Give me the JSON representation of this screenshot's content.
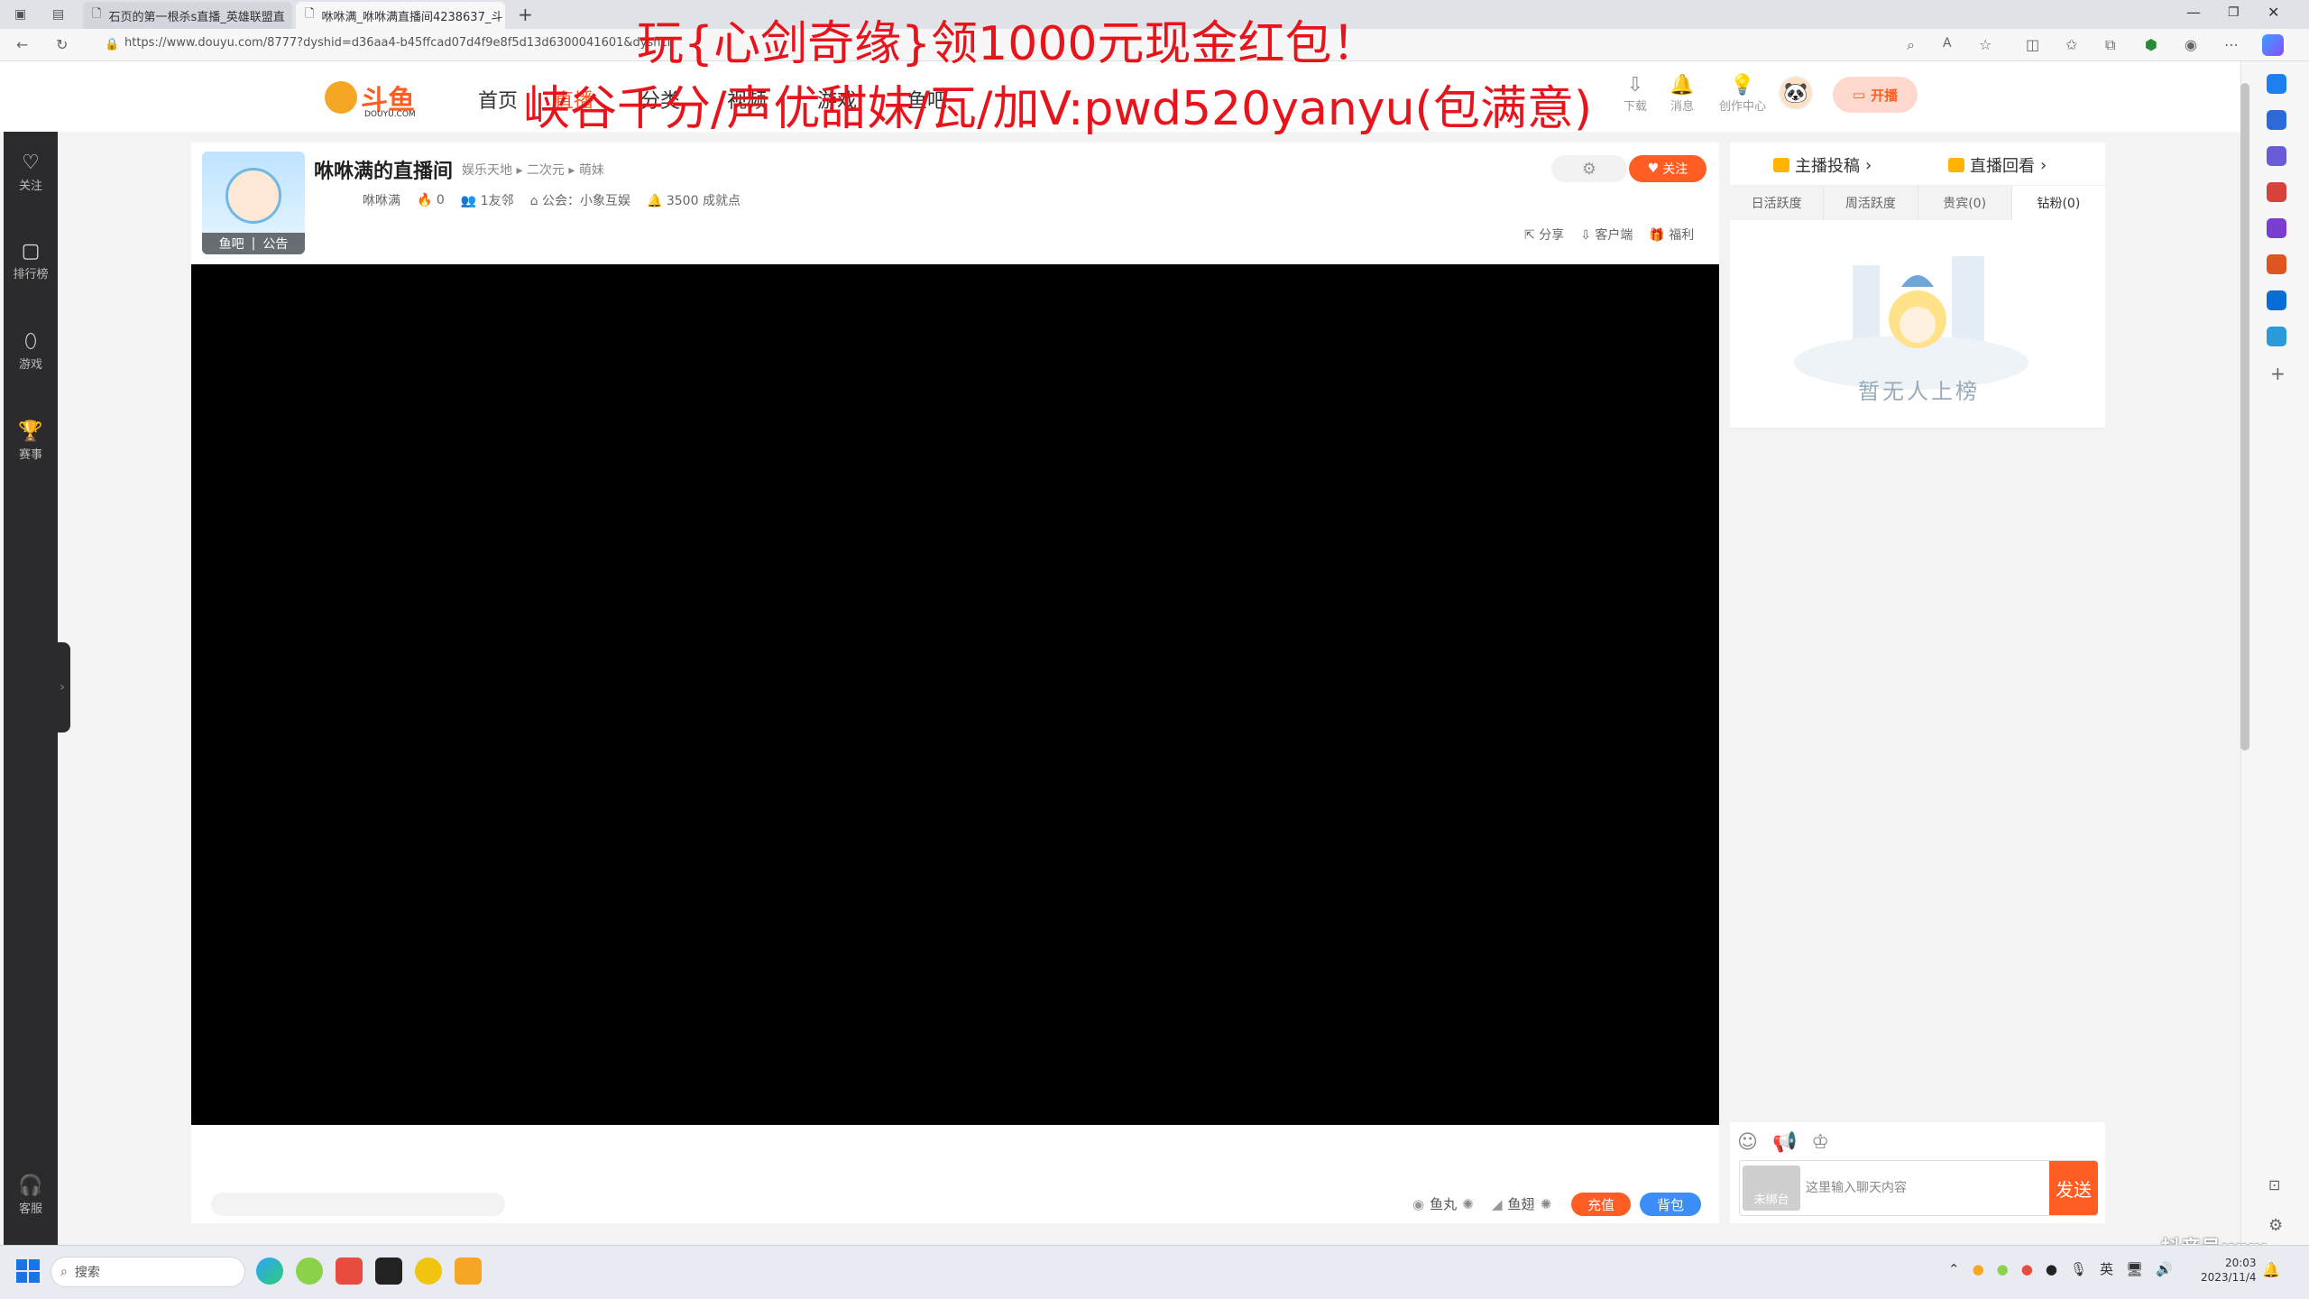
{
  "browser": {
    "tabs": [
      {
        "label": "石页的第一根杀s直播_英雄联盟直",
        "active": false
      },
      {
        "label": "咻咻满_咻咻满直播间4238637_斗",
        "active": true
      }
    ],
    "url": "https://www.douyu.com/8777?dyshid=d36aa4-b45ffcad07d4f9e8f5d13d6300041601&dyshci"
  },
  "overlay_ad": {
    "line1": "玩{心剑奇缘}领1000元现金红包！",
    "line2": "峡谷千分/声优甜妹/瓦/加V:pwd520yanyu(包满意)"
  },
  "header": {
    "logo_text": "斗鱼",
    "logo_sub": "DOUYU.COM",
    "nav": [
      "首页",
      "直播",
      "分类",
      "视频",
      "游戏",
      "鱼吧"
    ],
    "icons": [
      {
        "label": "下载",
        "icon": "download-icon"
      },
      {
        "label": "消息",
        "icon": "bell-icon"
      },
      {
        "label": "创作中心",
        "icon": "bulb-icon"
      }
    ],
    "live_button": "开播"
  },
  "left_rail": {
    "items": [
      {
        "label": "关注",
        "icon": "heart-icon"
      },
      {
        "label": "排行榜",
        "icon": "ranking-icon"
      },
      {
        "label": "游戏",
        "icon": "mouse-icon"
      },
      {
        "label": "赛事",
        "icon": "trophy-icon"
      }
    ],
    "bottom": {
      "label": "客服",
      "icon": "headset-icon"
    }
  },
  "room": {
    "title": "咻咻满的直播间",
    "category": [
      "娱乐天地",
      "二次元",
      "萌妹"
    ],
    "streamer": "咻咻满",
    "heat": "0",
    "friends": "1友邻",
    "guild": "公会：小象互娱",
    "achievement": "3500 成就点",
    "avatar_links": [
      "鱼吧",
      "公告"
    ],
    "follow_label": "关注",
    "actions": [
      "分享",
      "客户端",
      "福利"
    ]
  },
  "bottom_bar": {
    "yuwan": "鱼丸",
    "yuchi": "鱼翅",
    "recharge": "充值",
    "bag": "背包"
  },
  "right_panel": {
    "top_buttons": [
      "主播投稿",
      "直播回看"
    ],
    "tabs": [
      "日活跃度",
      "周活跃度",
      "贵宾(0)",
      "钻粉(0)"
    ],
    "active_tab": 3,
    "empty_text": "暂无人上榜",
    "unbound_label": "未绑台",
    "chat_placeholder": "这里输入聊天内容",
    "send": "发送"
  },
  "watermark": "抖音号:xxx",
  "taskbar": {
    "search": "搜索",
    "tray_lang": "英",
    "time": "20:03",
    "date": "2023/11/4"
  }
}
